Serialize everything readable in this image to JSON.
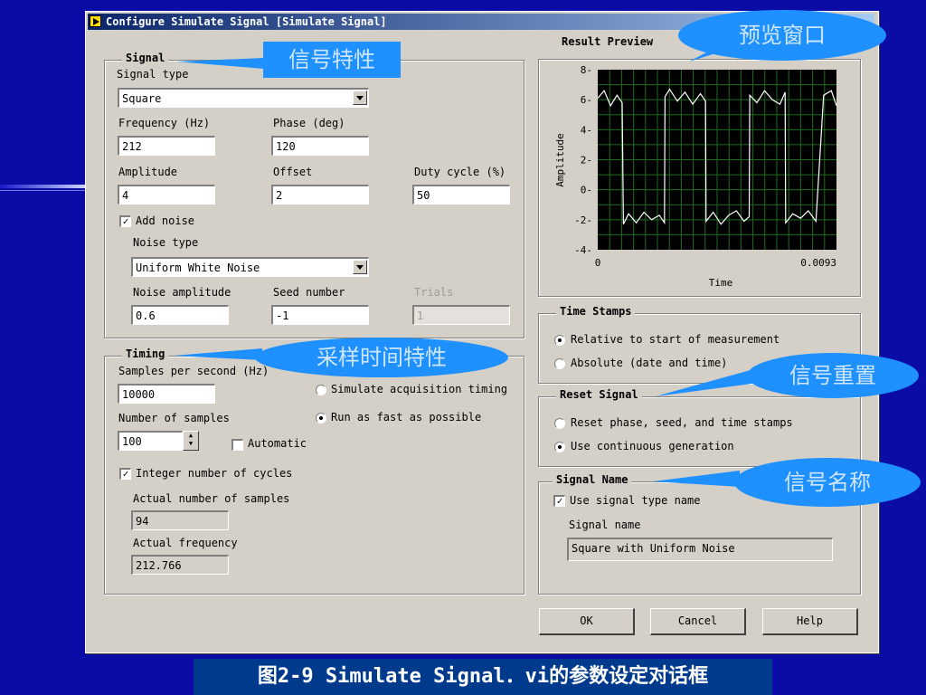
{
  "caption": "图2-9 Simulate Signal．vi的参数设定对话框",
  "dialog": {
    "title": "Configure Simulate Signal [Simulate Signal]"
  },
  "signal": {
    "title": "Signal",
    "type_label": "Signal type",
    "type_value": "Square",
    "freq_label": "Frequency (Hz)",
    "freq_value": "212",
    "phase_label": "Phase (deg)",
    "phase_value": "120",
    "amp_label": "Amplitude",
    "amp_value": "4",
    "offset_label": "Offset",
    "offset_value": "2",
    "duty_label": "Duty cycle (%)",
    "duty_value": "50",
    "add_noise_label": "Add noise",
    "add_noise_checked": true,
    "noise_type_label": "Noise type",
    "noise_type_value": "Uniform White Noise",
    "noise_amp_label": "Noise amplitude",
    "noise_amp_value": "0.6",
    "seed_label": "Seed number",
    "seed_value": "-1",
    "trials_label": "Trials",
    "trials_value": "1"
  },
  "timing": {
    "title": "Timing",
    "sps_label": "Samples per second (Hz)",
    "sps_value": "10000",
    "sim_acq_label": "Simulate acquisition timing",
    "run_fast_label": "Run as fast as possible",
    "nsamp_label": "Number of samples",
    "nsamp_value": "100",
    "automatic_label": "Automatic",
    "integer_label": "Integer number of cycles",
    "actual_n_label": "Actual number of samples",
    "actual_n_value": "94",
    "actual_f_label": "Actual frequency",
    "actual_f_value": "212.766"
  },
  "preview": {
    "title": "Result Preview",
    "ylabel": "Amplitude",
    "xlabel": "Time",
    "yticks": [
      "8",
      "6",
      "4",
      "2",
      "0",
      "-2",
      "-4"
    ],
    "xticks": [
      "0",
      "0.0093"
    ]
  },
  "time_stamps": {
    "title": "Time Stamps",
    "relative_label": "Relative to start of measurement",
    "absolute_label": "Absolute (date and time)"
  },
  "reset": {
    "title": "Reset Signal",
    "reset_label": "Reset phase, seed, and time stamps",
    "continuous_label": "Use continuous generation"
  },
  "signal_name": {
    "title": "Signal Name",
    "use_type_label": "Use signal type name",
    "name_label": "Signal name",
    "name_value": "Square with Uniform Noise"
  },
  "buttons": {
    "ok": "OK",
    "cancel": "Cancel",
    "help": "Help"
  },
  "callouts": {
    "preview": "预览窗口",
    "signal": "信号特性",
    "timing": "采样时间特性",
    "reset": "信号重置",
    "name": "信号名称"
  },
  "colors": {
    "callout": "#1e90ff",
    "plot_bg": "#000000",
    "plot_grid": "#1f6b1f",
    "plot_line": "#ffffff"
  },
  "chart_data": {
    "type": "line",
    "title": "Result Preview",
    "xlabel": "Time",
    "ylabel": "Amplitude",
    "xlim": [
      0,
      0.0093
    ],
    "ylim": [
      -4,
      8
    ],
    "grid": true,
    "series": [
      {
        "x": [
          0,
          0.00025,
          0.0005,
          0.00075,
          0.00095,
          0.001,
          0.0012,
          0.0015,
          0.0018,
          0.0021,
          0.0024,
          0.0026,
          0.00262,
          0.0028,
          0.0031,
          0.0034,
          0.0037,
          0.004,
          0.0042,
          0.00422,
          0.0045,
          0.0048,
          0.0051,
          0.0054,
          0.0057,
          0.0059,
          0.00592,
          0.0062,
          0.0065,
          0.0068,
          0.0071,
          0.0073,
          0.00732,
          0.0076,
          0.0079,
          0.0082,
          0.0085,
          0.0088,
          0.0091,
          0.0093
        ],
        "y": [
          6.1,
          6.6,
          5.6,
          6.3,
          5.8,
          -2.3,
          -1.6,
          -2.2,
          -1.5,
          -2.0,
          -1.7,
          -2.2,
          6.2,
          6.7,
          5.9,
          6.5,
          5.7,
          6.4,
          5.9,
          -2.1,
          -1.5,
          -2.3,
          -1.7,
          -1.4,
          -2.1,
          -1.8,
          6.3,
          5.8,
          6.6,
          6.0,
          5.7,
          6.5,
          -2.2,
          -1.6,
          -1.9,
          -1.4,
          -2.1,
          6.3,
          6.6,
          5.6
        ]
      }
    ]
  }
}
